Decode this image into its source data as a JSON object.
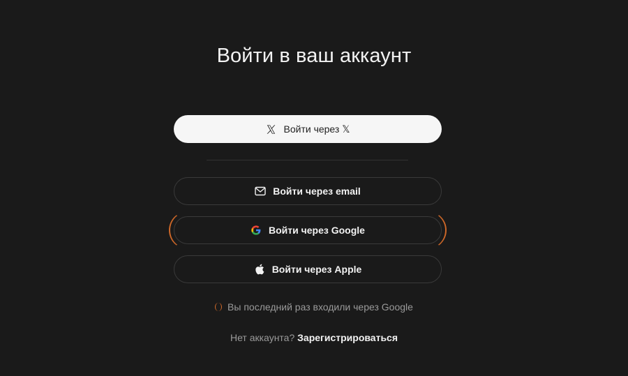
{
  "heading": "Войти в ваш аккаунт",
  "buttons": {
    "x": {
      "label": "Войти через 𝕏",
      "icon": "x-logo-icon"
    },
    "email": {
      "label": "Войти через email",
      "icon": "envelope-icon"
    },
    "google": {
      "label": "Войти через Google",
      "icon": "google-logo-icon"
    },
    "apple": {
      "label": "Войти через Apple",
      "icon": "apple-logo-icon"
    }
  },
  "last_login_hint": "Вы последний раз входили через Google",
  "signup": {
    "prompt": "Нет аккаунта?",
    "link": "Зарегистрироваться"
  },
  "colors": {
    "background": "#1a1a1a",
    "accent": "#e0702a",
    "primary_button": "#f6f6f6"
  }
}
